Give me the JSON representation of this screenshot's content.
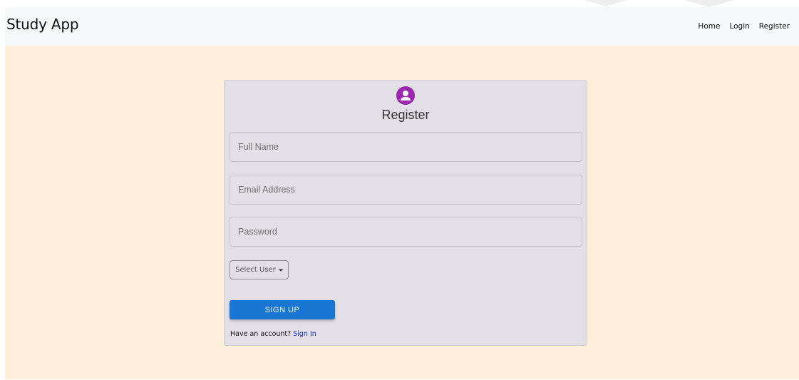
{
  "app": {
    "brand": "Study App"
  },
  "nav": {
    "items": [
      "Home",
      "Login",
      "Register"
    ]
  },
  "register": {
    "title": "Register",
    "avatar_icon": "person-icon",
    "fields": {
      "full_name_placeholder": "Full Name",
      "email_placeholder": "Email Address",
      "password_placeholder": "Password"
    },
    "select_user_label": "Select User",
    "signup_label": "SIGN UP",
    "footer_prompt": "Have an account?",
    "footer_link": "Sign In"
  },
  "colors": {
    "page_background": "#feeeda",
    "navbar_background": "#f8f9fb",
    "card_background": "#e2dfe6",
    "avatar": "#9c27b0",
    "primary_button": "#1976d2",
    "link": "#1a33a8"
  }
}
